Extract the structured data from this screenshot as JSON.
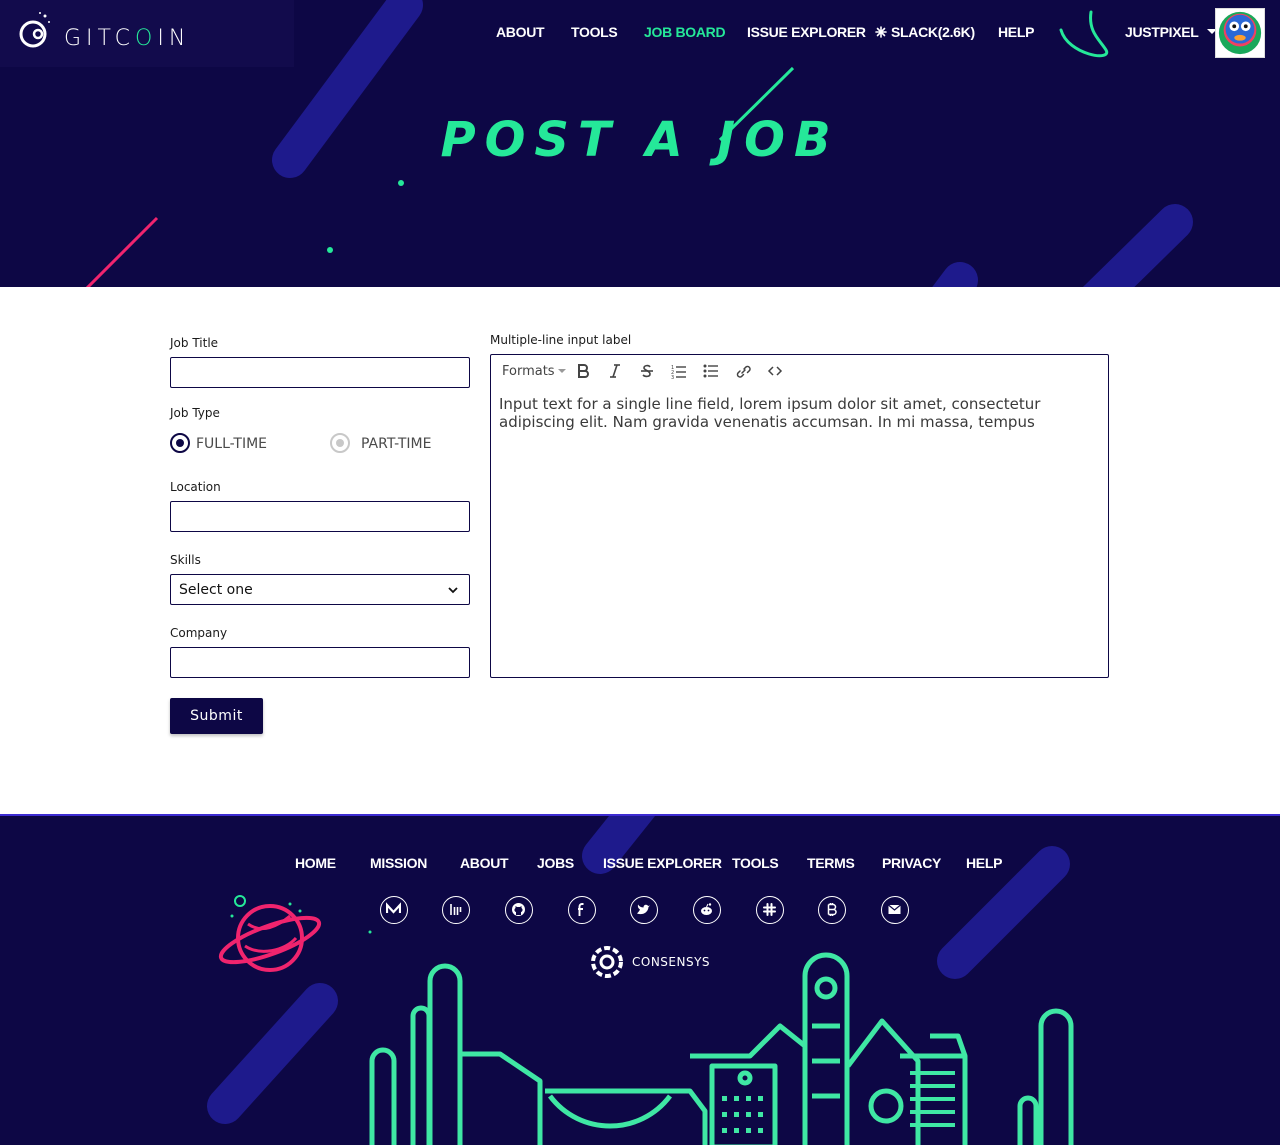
{
  "header": {
    "logo_text_pre": "GITC",
    "logo_text_o": "O",
    "logo_text_post": "IN",
    "nav": [
      {
        "label": "ABOUT"
      },
      {
        "label": "TOOLS"
      },
      {
        "label": "JOB BOARD"
      },
      {
        "label": "ISSUE EXPLORER"
      },
      {
        "label": "SLACK(2.6K)"
      },
      {
        "label": "HELP"
      }
    ],
    "username": "JUSTPIXEL",
    "active_nav": "JOB BOARD"
  },
  "hero": {
    "title": "POST A JOB"
  },
  "form": {
    "job_title_label": "Job Title",
    "job_type_label": "Job Type",
    "job_type_options": [
      {
        "label": "FULL-TIME",
        "selected": true
      },
      {
        "label": "PART-TIME",
        "selected": false
      }
    ],
    "location_label": "Location",
    "skills_label": "Skills",
    "skills_value": "Select one",
    "company_label": "Company",
    "submit_label": "Submit",
    "description_label": "Multiple-line input label",
    "toolbar_formats": "Formats",
    "toolbar_icons": [
      "bold-icon",
      "italic-icon",
      "strikethrough-icon",
      "ordered-list-icon",
      "bullet-list-icon",
      "link-icon",
      "code-icon"
    ],
    "description_value": "Input text for a single line field, lorem ipsum dolor sit amet, consectetur adipiscing elit. Nam gravida venenatis accumsan. In mi massa, tempus"
  },
  "footer": {
    "nav": [
      {
        "label": "HOME"
      },
      {
        "label": "MISSION"
      },
      {
        "label": "ABOUT"
      },
      {
        "label": "JOBS"
      },
      {
        "label": "ISSUE EXPLORER"
      },
      {
        "label": "TOOLS"
      },
      {
        "label": "TERMS"
      },
      {
        "label": "PRIVACY"
      },
      {
        "label": "HELP"
      }
    ],
    "social_icons": [
      "medium-icon",
      "gitter-icon",
      "github-icon",
      "facebook-icon",
      "twitter-icon",
      "reddit-icon",
      "slack-icon",
      "bitcoin-icon",
      "email-icon"
    ],
    "partner": "CONSENSYS"
  },
  "colors": {
    "navy": "#0d0745",
    "accent_green": "#25e899",
    "accent_pink": "#f0246e",
    "deco_blue": "#1e1a8c"
  }
}
